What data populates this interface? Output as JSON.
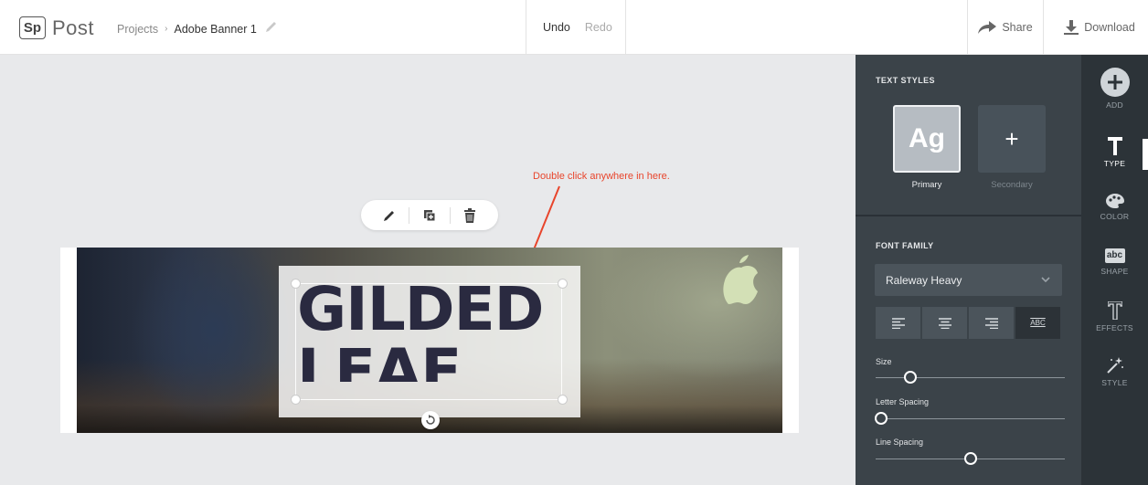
{
  "app": {
    "logo_mark": "Sp",
    "name": "Post"
  },
  "breadcrumb": {
    "root": "Projects",
    "current": "Adobe Banner 1"
  },
  "history": {
    "undo": "Undo",
    "redo": "Redo"
  },
  "actions": {
    "share": "Share",
    "download": "Download"
  },
  "canvas": {
    "annotation": "Double click anywhere in here.",
    "headline_line1": "GILDED",
    "headline_line2": "LEAF CO."
  },
  "text_styles": {
    "title": "TEXT STYLES",
    "primary_glyph": "Ag",
    "primary_label": "Primary",
    "secondary_glyph": "+",
    "secondary_label": "Secondary"
  },
  "font_family": {
    "title": "FONT FAMILY",
    "selected": "Raleway Heavy",
    "align_buttons": [
      "align-left",
      "align-center",
      "align-right",
      "all-caps"
    ],
    "caps_label": "ABC"
  },
  "sliders": {
    "size": {
      "label": "Size",
      "value_fraction": 0.18
    },
    "letter_spacing": {
      "label": "Letter Spacing",
      "value_fraction": 0.03
    },
    "line_spacing": {
      "label": "Line Spacing",
      "value_fraction": 0.5
    }
  },
  "rail": {
    "add": "ADD",
    "type": "TYPE",
    "color": "COLOR",
    "shape": "SHAPE",
    "shape_glyph": "abc",
    "effects": "EFFECTS",
    "style": "STYLE"
  },
  "colors": {
    "panel": "#3b4349",
    "rail": "#2c3338",
    "annotation": "#e8452c",
    "canvas": "#e8e9eb"
  }
}
